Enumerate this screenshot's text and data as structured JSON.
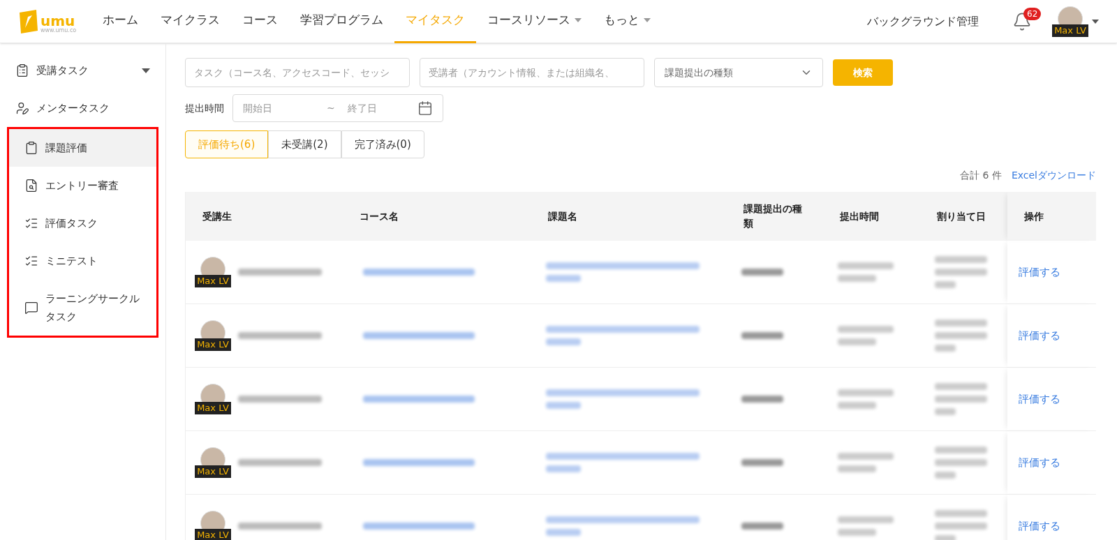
{
  "header": {
    "logo_text": "umu",
    "logo_url": "www.umu.co",
    "nav": [
      {
        "label": "ホーム",
        "selected": false,
        "has_dropdown": false
      },
      {
        "label": "マイクラス",
        "selected": false,
        "has_dropdown": false
      },
      {
        "label": "コース",
        "selected": false,
        "has_dropdown": false
      },
      {
        "label": "学習プログラム",
        "selected": false,
        "has_dropdown": false
      },
      {
        "label": "マイタスク",
        "selected": true,
        "has_dropdown": false
      },
      {
        "label": "コースリソース",
        "selected": false,
        "has_dropdown": true
      },
      {
        "label": "もっと",
        "selected": false,
        "has_dropdown": true
      }
    ],
    "admin_link": "バックグラウンド管理",
    "notification_count": "62",
    "avatar_label": "Max LV"
  },
  "sidebar": {
    "items": [
      {
        "label": "受講タスク",
        "selected": false,
        "has_caret": true
      },
      {
        "label": "メンタータスク",
        "selected": false,
        "has_caret": false
      }
    ],
    "highlighted_items": [
      {
        "label": "課題評価",
        "selected": true,
        "has_caret": false
      },
      {
        "label": "エントリー審査",
        "selected": false,
        "has_caret": false
      },
      {
        "label": "評価タスク",
        "selected": false,
        "has_caret": false
      },
      {
        "label": "ミニテスト",
        "selected": false,
        "has_caret": false
      },
      {
        "label": "ラーニングサークルタスク",
        "selected": false,
        "has_caret": false
      }
    ]
  },
  "filters": {
    "task_search": {
      "placeholder": "タスク（コース名、アクセスコード、セッシ"
    },
    "learner_search": {
      "placeholder": "受講者（アカウント情報、または組織名、"
    },
    "type_select": {
      "placeholder": "課題提出の種類"
    },
    "search_button": "検索",
    "date_label": "提出時間",
    "start_placeholder": "開始日",
    "separator": "~",
    "end_placeholder": "終了日"
  },
  "status_tabs": [
    {
      "label": "評価待ち(6)",
      "selected": true
    },
    {
      "label": "未受講(2)",
      "selected": false
    },
    {
      "label": "完了済み(0)",
      "selected": false
    }
  ],
  "summary": {
    "total": "合計 6 件",
    "export_link": "Excelダウンロード"
  },
  "table": {
    "columns": [
      "受講生",
      "コース名",
      "課題名",
      "課題提出の種類",
      "提出時間",
      "割り当て日",
      "操作"
    ],
    "rows": [
      {
        "avatar_label": "Max LV",
        "action": "評価する"
      },
      {
        "avatar_label": "Max LV",
        "action": "評価する"
      },
      {
        "avatar_label": "Max LV",
        "action": "評価する"
      },
      {
        "avatar_label": "Max LV",
        "action": "評価する"
      },
      {
        "avatar_label": "Max LV",
        "action": "評価する"
      }
    ]
  }
}
